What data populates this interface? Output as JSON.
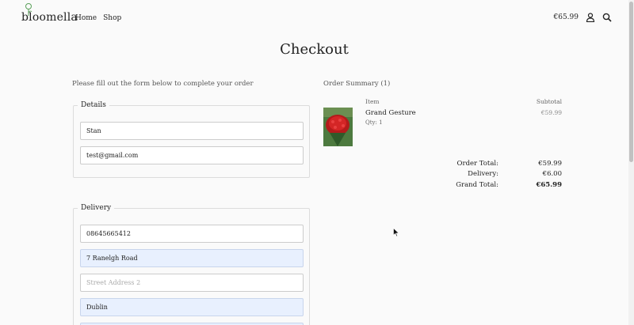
{
  "header": {
    "logo_text": "bloomella",
    "nav": [
      "Home",
      "Shop"
    ],
    "cart_total": "€65.99",
    "icons": [
      "user-icon",
      "search-icon"
    ]
  },
  "page_title": "Checkout",
  "form": {
    "intro": "Please fill out the form below to complete your order",
    "details": {
      "legend": "Details",
      "name_value": "Stan",
      "email_value": "test@gmail.com"
    },
    "delivery": {
      "legend": "Delivery",
      "phone_value": "08645665412",
      "street1_value": "7 Ranelgh Road",
      "street2_placeholder": "Street Address 2",
      "city_value": "Dublin"
    }
  },
  "summary": {
    "title": "Order Summary (1)",
    "col_item": "Item",
    "col_subtotal": "Subtotal",
    "product": {
      "name": "Grand Gesture",
      "qty": "Qty: 1",
      "price": "€59.99"
    },
    "totals": {
      "order_total_label": "Order Total:",
      "order_total_value": "€59.99",
      "delivery_label": "Delivery:",
      "delivery_value": "€6.00",
      "grand_total_label": "Grand Total:",
      "grand_total_value": "€65.99"
    }
  },
  "colors": {
    "autofill_bg": "#e8f0fe",
    "background": "#fafafa"
  }
}
